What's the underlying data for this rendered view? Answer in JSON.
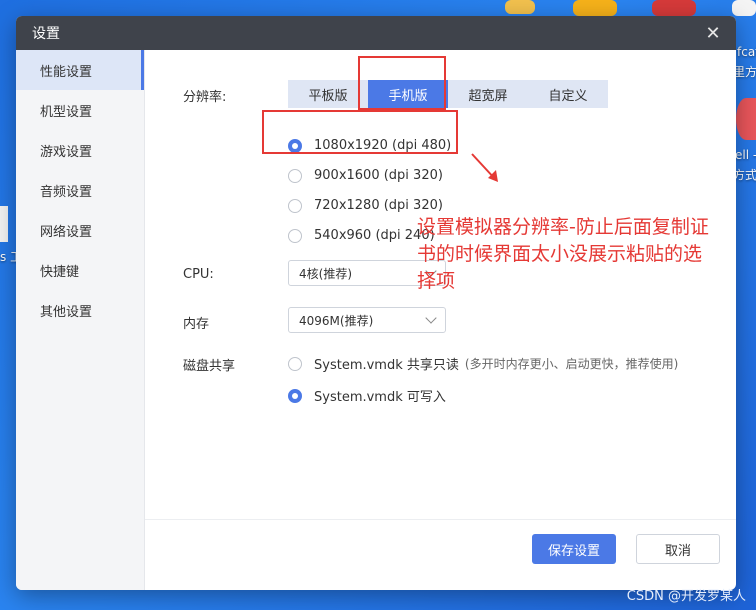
{
  "dialog": {
    "title": "设置"
  },
  "sidebar": {
    "items": [
      {
        "label": "性能设置",
        "active": true
      },
      {
        "label": "机型设置"
      },
      {
        "label": "游戏设置"
      },
      {
        "label": "音频设置"
      },
      {
        "label": "网络设置"
      },
      {
        "label": "快捷键"
      },
      {
        "label": "其他设置"
      }
    ]
  },
  "resolution": {
    "label": "分辨率:",
    "tabs": [
      "平板版",
      "手机版",
      "超宽屏",
      "自定义"
    ],
    "active_tab": "手机版",
    "options": [
      "1080x1920 (dpi 480)",
      "900x1600 (dpi 320)",
      "720x1280 (dpi 320)",
      "540x960 (dpi 240)"
    ],
    "selected": "1080x1920 (dpi 480)"
  },
  "cpu": {
    "label": "CPU:",
    "value": "4核(推荐)"
  },
  "memory": {
    "label": "内存",
    "value": "4096M(推荐)"
  },
  "disk": {
    "label": "磁盘共享",
    "option1": "System.vmdk 共享只读",
    "option1_hint": "(多开时内存更小、启动更快，推荐使用)",
    "option2": "System.vmdk 可写入",
    "selected": "System.vmdk 可写入"
  },
  "footer": {
    "save": "保存设置",
    "cancel": "取消"
  },
  "annotation": {
    "line1": "设置模拟器分辨率-防止后面复制证",
    "line2": "书的时候界面太小没展示粘贴的选",
    "line3": "择项"
  },
  "desktop": {
    "text1": "fcat",
    "text2": "里方式",
    "text3": "ell -",
    "text4": "方式",
    "text5": "s 工"
  },
  "watermark": "CSDN @开发罗某人",
  "colors": {
    "accent": "#4b79e6",
    "annotation": "#e53935",
    "titlebar": "#3f434b"
  }
}
